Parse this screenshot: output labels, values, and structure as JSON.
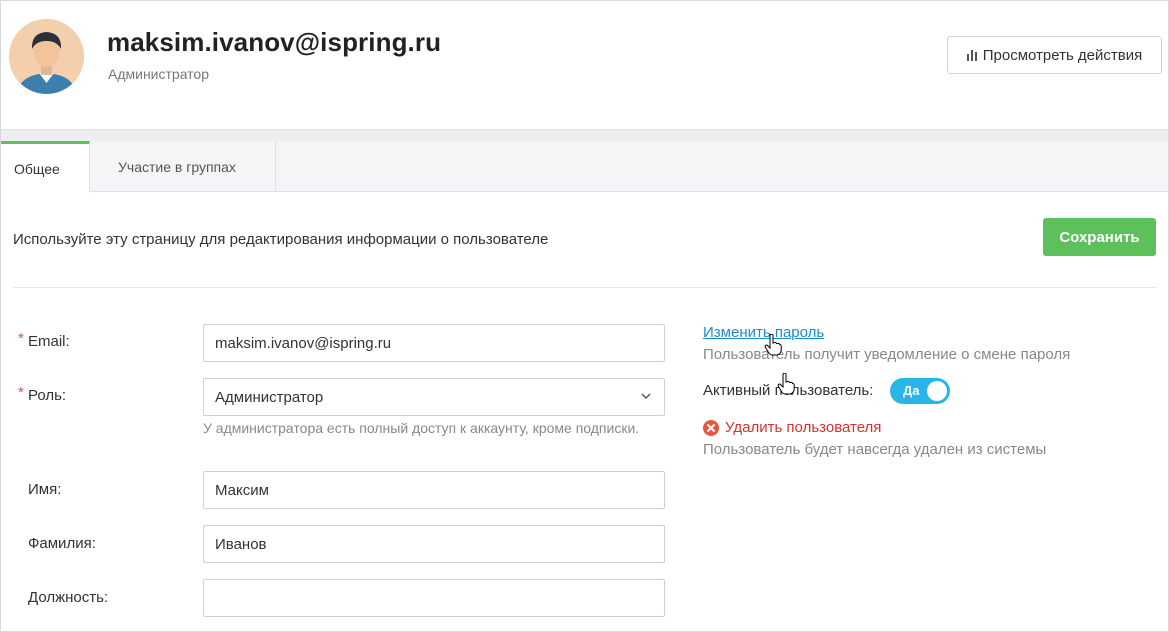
{
  "header": {
    "email": "maksim.ivanov@ispring.ru",
    "role": "Администратор",
    "actions_button": "Просмотреть действия"
  },
  "tabs": [
    {
      "label": "Общее",
      "active": true
    },
    {
      "label": "Участие в группах",
      "active": false
    }
  ],
  "page": {
    "info_text": "Используйте эту страницу для редактирования информации о пользователе",
    "save_button": "Сохранить"
  },
  "form": {
    "required_mark": "*",
    "email": {
      "label": "Email:",
      "value": "maksim.ivanov@ispring.ru"
    },
    "role": {
      "label": "Роль:",
      "value": "Администратор",
      "hint": "У администратора есть полный доступ к аккаунту, кроме подписки."
    },
    "first_name": {
      "label": "Имя:",
      "value": "Максим"
    },
    "last_name": {
      "label": "Фамилия:",
      "value": "Иванов"
    },
    "position": {
      "label": "Должность:",
      "value": ""
    }
  },
  "side": {
    "change_password": "Изменить пароль",
    "password_note": "Пользователь получит уведомление о смене пароля",
    "active_label": "Активный пользователь:",
    "active_toggle": "Да",
    "delete_link": "Удалить пользователя",
    "delete_note": "Пользователь будет навсегда удален из системы"
  },
  "colors": {
    "accent_green": "#5cc15a",
    "link_blue": "#1a8ccf",
    "toggle_blue": "#29b5e8",
    "danger_red": "#d6322d"
  },
  "icons": [
    "bar-chart-icon",
    "chevron-down-icon",
    "close-circle-icon",
    "hand-pointer-icon"
  ]
}
